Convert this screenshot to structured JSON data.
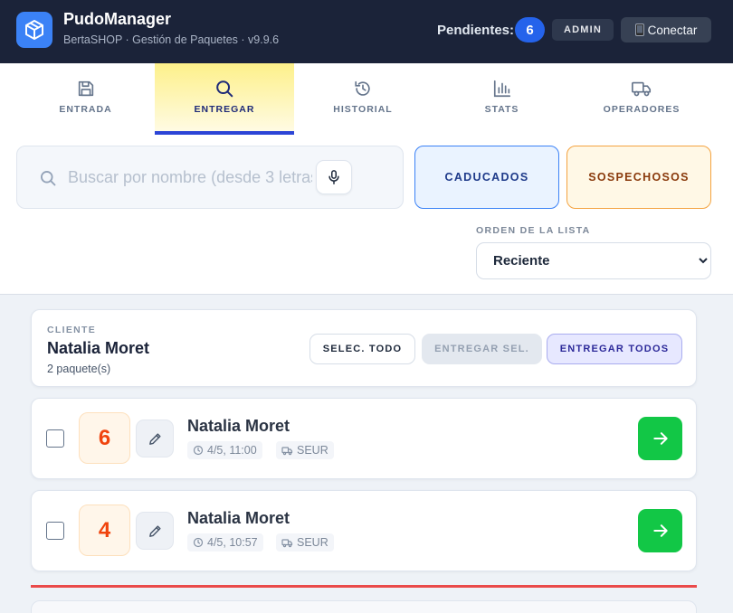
{
  "app": {
    "title": "PudoManager",
    "subtitle": "BertaSHOP · Gestión de Paquetes · v9.9.6",
    "pending_label": "Pendientes:",
    "pending_count": "6",
    "role": "ADMIN",
    "connect_label": "Conectar"
  },
  "tabs": [
    {
      "label": "ENTRADA",
      "icon": "save-icon",
      "active": false
    },
    {
      "label": "ENTREGAR",
      "icon": "search-icon",
      "active": true
    },
    {
      "label": "HISTORIAL",
      "icon": "history-icon",
      "active": false
    },
    {
      "label": "STATS",
      "icon": "bar-chart-icon",
      "active": false
    },
    {
      "label": "OPERADORES",
      "icon": "truck-icon",
      "active": false
    }
  ],
  "search": {
    "placeholder": "Buscar por nombre (desde 3 letras)",
    "value": ""
  },
  "filters": {
    "caducados": "CADUCADOS",
    "sospechosos": "SOSPECHOSOS"
  },
  "order": {
    "label": "ORDEN DE LA LISTA",
    "selected": "Reciente"
  },
  "client": {
    "caption": "CLIENTE",
    "name": "Natalia Moret",
    "count": "2 paquete(s)",
    "select_all": "SELEC. TODO",
    "deliver_selected": "ENTREGAR SEL.",
    "deliver_all": "ENTREGAR TODOS"
  },
  "packages": [
    {
      "number": "6",
      "name": "Natalia Moret",
      "datetime": "4/5, 11:00",
      "carrier": "SEUR"
    },
    {
      "number": "4",
      "name": "Natalia Moret",
      "datetime": "4/5, 10:57",
      "carrier": "SEUR"
    }
  ],
  "colors": {
    "header_bg": "#1b2339",
    "accent": "#2563eb",
    "active_tab": "#fdf08a",
    "deliver_green": "#12c746",
    "number_orange": "#f0440e",
    "divider_red": "#ea4a4a"
  }
}
